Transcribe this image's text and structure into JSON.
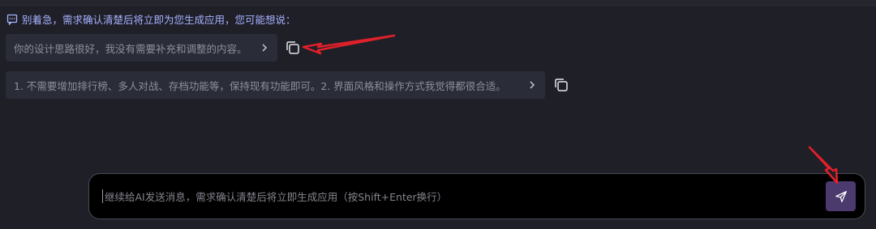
{
  "hint": {
    "icon": "chat-bubble-icon",
    "text": "别着急，需求确认清楚后将立即为您生成应用，您可能想说："
  },
  "suggestions": [
    {
      "text": "你的设计思路很好，我没有需要补充和调整的内容。"
    },
    {
      "text": "1. 不需要增加排行榜、多人对战、存档功能等，保持现有功能即可。2. 界面风格和操作方式我觉得都很合适。"
    }
  ],
  "composer": {
    "placeholder": "继续给AI发送消息，需求确认清楚后将立即生成应用（按Shift+Enter换行）",
    "send_icon": "paper-plane-icon"
  },
  "colors": {
    "background": "#1f1f28",
    "hint_text": "#a7b3ff",
    "suggestion_bg": "#2a2c38",
    "send_button": "#4a3a6e",
    "annotation_arrow": "#e0202a"
  }
}
